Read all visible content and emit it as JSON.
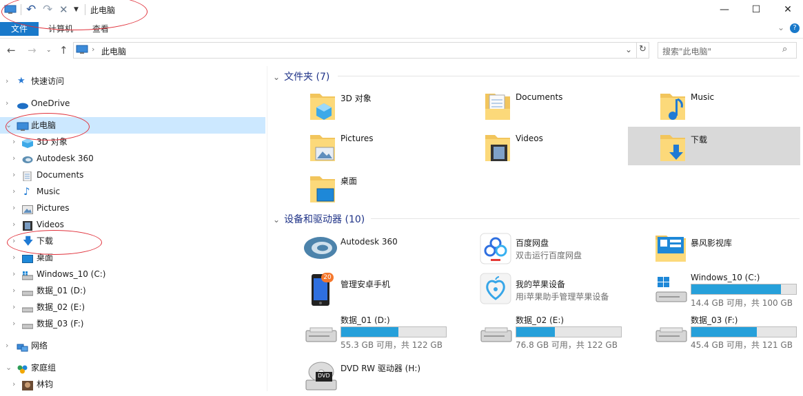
{
  "titlebar": {
    "title": "此电脑",
    "buttons": {
      "minimize": "—",
      "maximize": "☐",
      "close": "✕"
    }
  },
  "ribbon": {
    "tabs": [
      {
        "label": "文件",
        "active": true
      },
      {
        "label": "计算机",
        "active": false
      },
      {
        "label": "查看",
        "active": false
      }
    ]
  },
  "address": {
    "path": "此电脑",
    "search_placeholder": "搜索\"此电脑\""
  },
  "nav": {
    "items": [
      {
        "label": "快速访问",
        "icon": "star-icon"
      },
      {
        "label": "OneDrive",
        "icon": "cloud-icon"
      },
      {
        "label": "此电脑",
        "icon": "computer-icon",
        "selected": true
      },
      {
        "label": "3D 对象",
        "icon": "cube-icon"
      },
      {
        "label": "Autodesk 360",
        "icon": "autodesk-icon"
      },
      {
        "label": "Documents",
        "icon": "document-icon"
      },
      {
        "label": "Music",
        "icon": "music-icon"
      },
      {
        "label": "Pictures",
        "icon": "pictures-icon"
      },
      {
        "label": "Videos",
        "icon": "video-icon"
      },
      {
        "label": "下载",
        "icon": "download-icon"
      },
      {
        "label": "桌面",
        "icon": "desktop-icon"
      },
      {
        "label": "Windows_10 (C:)",
        "icon": "windows-drive-icon"
      },
      {
        "label": "数据_01 (D:)",
        "icon": "drive-icon"
      },
      {
        "label": "数据_02 (E:)",
        "icon": "drive-icon"
      },
      {
        "label": "数据_03 (F:)",
        "icon": "drive-icon"
      },
      {
        "label": "网络",
        "icon": "network-icon"
      },
      {
        "label": "家庭组",
        "icon": "homegroup-icon"
      },
      {
        "label": "林钧",
        "icon": "user-icon"
      }
    ]
  },
  "folders": {
    "header": "文件夹 (7)",
    "items": [
      {
        "label": "3D 对象"
      },
      {
        "label": "Documents"
      },
      {
        "label": "Music"
      },
      {
        "label": "Pictures"
      },
      {
        "label": "Videos"
      },
      {
        "label": "下载",
        "selected": true
      },
      {
        "label": "桌面"
      }
    ]
  },
  "devices": {
    "header": "设备和驱动器 (10)",
    "items": [
      {
        "label": "Autodesk 360",
        "sub": ""
      },
      {
        "label": "百度网盘",
        "sub": "双击运行百度网盘"
      },
      {
        "label": "暴风影视库",
        "sub": ""
      },
      {
        "label": "管理安卓手机",
        "sub": ""
      },
      {
        "label": "我的苹果设备",
        "sub": "用i苹果助手管理苹果设备"
      },
      {
        "label": "Windows_10 (C:)",
        "sub": "14.4 GB 可用，共 100 GB",
        "used_fraction": 0.856
      },
      {
        "label": "数据_01 (D:)",
        "sub": "55.3 GB 可用，共 122 GB",
        "used_fraction": 0.547
      },
      {
        "label": "数据_02 (E:)",
        "sub": "76.8 GB 可用，共 122 GB",
        "used_fraction": 0.37
      },
      {
        "label": "数据_03 (F:)",
        "sub": "45.4 GB 可用，共 121 GB",
        "used_fraction": 0.625
      },
      {
        "label": "DVD RW 驱动器 (H:)",
        "sub": ""
      }
    ]
  },
  "badges": {
    "android": "20",
    "dvd": "DVD"
  },
  "colors": {
    "accent": "#1979ca",
    "selection": "#cce8ff",
    "bar_fill": "#26a0da",
    "annotation": "#e0303a"
  }
}
